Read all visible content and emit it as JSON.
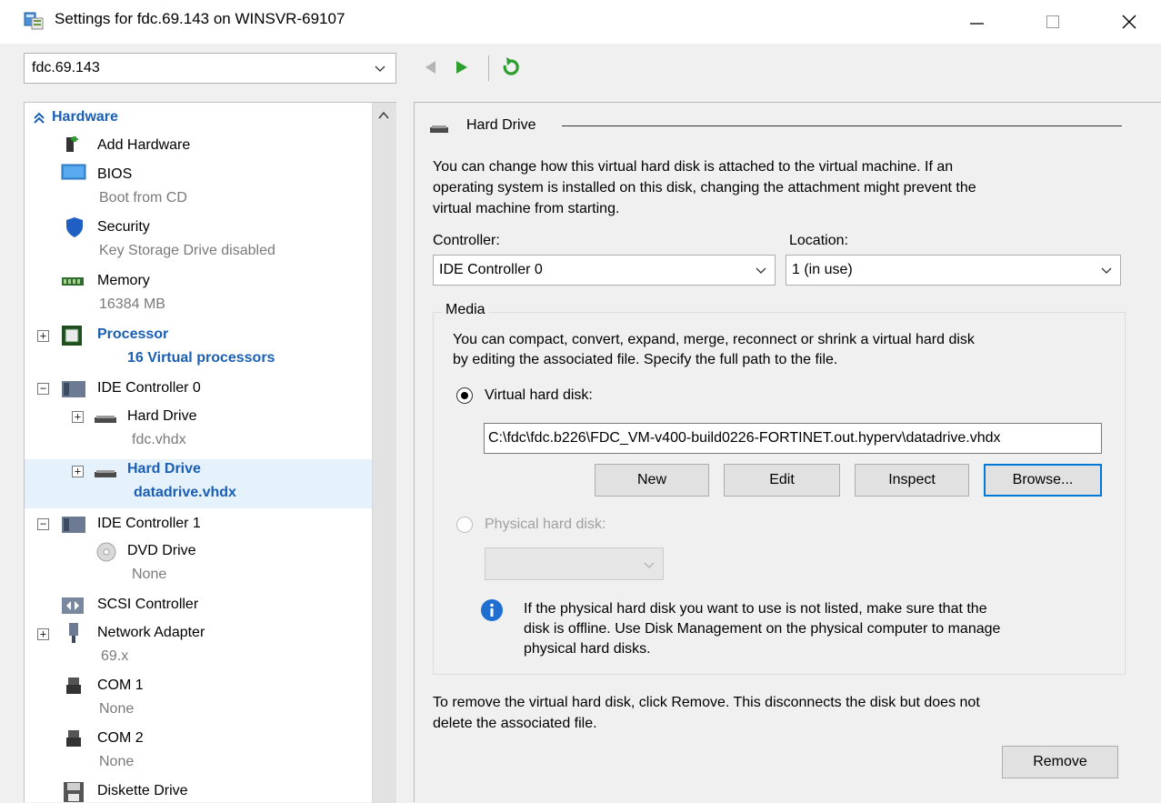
{
  "window": {
    "title": "Settings for fdc.69.143 on WINSVR-69107"
  },
  "vm_selector": {
    "value": "fdc.69.143"
  },
  "tree": {
    "hardware_header": "Hardware",
    "items": [
      {
        "label": "Add Hardware"
      },
      {
        "label": "BIOS",
        "sub": "Boot from CD"
      },
      {
        "label": "Security",
        "sub": "Key Storage Drive disabled"
      },
      {
        "label": "Memory",
        "sub": "16384 MB"
      },
      {
        "label": "Processor",
        "sub": "16 Virtual processors"
      },
      {
        "label": "IDE Controller 0"
      },
      {
        "label": "Hard Drive",
        "sub": "fdc.vhdx"
      },
      {
        "label": "Hard Drive",
        "sub": "datadrive.vhdx"
      },
      {
        "label": "IDE Controller 1"
      },
      {
        "label": "DVD Drive",
        "sub": "None"
      },
      {
        "label": "SCSI Controller"
      },
      {
        "label": "Network Adapter",
        "sub": "69.x"
      },
      {
        "label": "COM 1",
        "sub": "None"
      },
      {
        "label": "COM 2",
        "sub": "None"
      },
      {
        "label": "Diskette Drive"
      }
    ]
  },
  "details": {
    "section_title": "Hard Drive",
    "intro_lines": [
      "You can change how this virtual hard disk is attached to the virtual machine. If an",
      "operating system is installed on this disk, changing the attachment might prevent the",
      "virtual machine from starting."
    ],
    "controller_label": "Controller:",
    "controller_value": "IDE Controller 0",
    "location_label": "Location:",
    "location_value": "1 (in use)",
    "media_label": "Media",
    "media_lines": [
      "You can compact, convert, expand, merge, reconnect or shrink a virtual hard disk",
      "by editing the associated file. Specify the full path to the file."
    ],
    "vhd_radio_label": "Virtual hard disk:",
    "vhd_path": "C:\\fdc\\fdc.b226\\FDC_VM-v400-build0226-FORTINET.out.hyperv\\datadrive.vhdx",
    "buttons": {
      "new": "New",
      "edit": "Edit",
      "inspect": "Inspect",
      "browse": "Browse..."
    },
    "phys_radio_label": "Physical hard disk:",
    "info_lines": [
      "If the physical hard disk you want to use is not listed, make sure that the",
      "disk is offline. Use Disk Management on the physical computer to manage",
      "physical hard disks."
    ],
    "remove_lines": [
      "To remove the virtual hard disk, click Remove. This disconnects the disk but does not",
      "delete the associated file."
    ],
    "remove_button": "Remove"
  },
  "colors": {
    "accent": "#0078d7",
    "tree_bold": "#1a5fb4",
    "selected_row": "#e5f1fb",
    "nav_green": "#2e9e2e"
  }
}
